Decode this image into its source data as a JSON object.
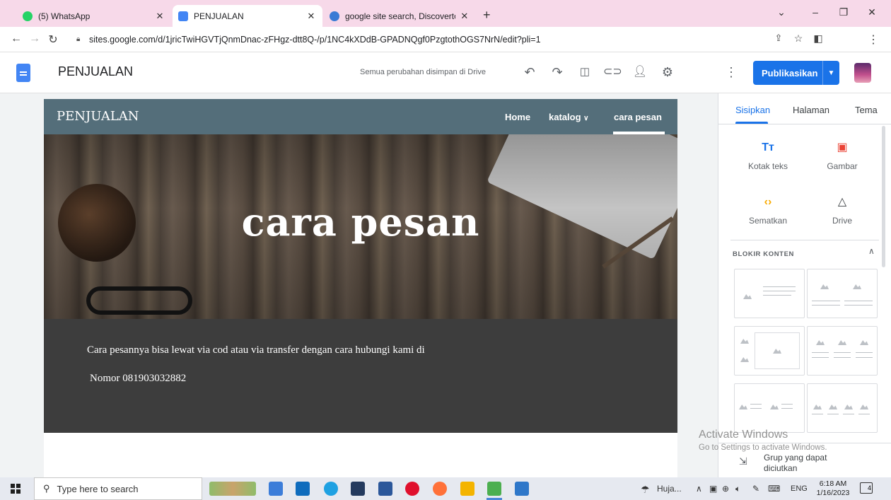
{
  "browser": {
    "tabs": [
      {
        "title": "(5) WhatsApp",
        "icon": "whatsapp-icon",
        "color": "#25d366",
        "active": false
      },
      {
        "title": "PENJUALAN",
        "icon": "google-sites-icon",
        "color": "#4285f4",
        "active": true
      },
      {
        "title": "google site search, Discovertoda",
        "icon": "ship-icon",
        "color": "#3a7bd5",
        "active": false
      }
    ],
    "new_tab": "+",
    "url": "sites.google.com/d/1jricTwiHGVTjQnmDnac-zFHgz-dtt8Q-/p/1NC4kXDdB-GPADNQgf0PzgtothOGS7NrN/edit?pli=1"
  },
  "editor": {
    "site_title": "PENJUALAN",
    "save_status": "Semua perubahan disimpan di Drive",
    "publish_label": "Publikasikan"
  },
  "site": {
    "name": "PENJUALAN",
    "nav": [
      "Home",
      "katalog",
      "cara pesan"
    ],
    "hero_title": "cara pesan",
    "paragraph_1": "Cara pesannya bisa lewat via cod atau via transfer dengan cara hubungi kami di",
    "paragraph_2": "Nomor 081903032882"
  },
  "panel": {
    "tabs": [
      "Sisipkan",
      "Halaman",
      "Tema"
    ],
    "tools": [
      {
        "label": "Kotak teks",
        "icon": "text-box-icon",
        "glyph": "Tт",
        "color": "#1a73e8"
      },
      {
        "label": "Gambar",
        "icon": "image-icon",
        "glyph": "▣",
        "color": "#ea4335"
      },
      {
        "label": "Sematkan",
        "icon": "embed-icon",
        "glyph": "‹›",
        "color": "#f9ab00"
      },
      {
        "label": "Drive",
        "icon": "drive-icon",
        "glyph": "△",
        "color": "#3c4043"
      }
    ],
    "blocks_header": "BLOKIR KONTEN",
    "group_label": "Grup yang dapat diciutkan"
  },
  "watermark": {
    "title": "Activate Windows",
    "subtitle": "Go to Settings to activate Windows."
  },
  "taskbar": {
    "search_placeholder": "Type here to search",
    "weather": "Huja...",
    "language": "ENG",
    "time": "6:18 AM",
    "date": "1/16/2023",
    "notifications": "4"
  }
}
